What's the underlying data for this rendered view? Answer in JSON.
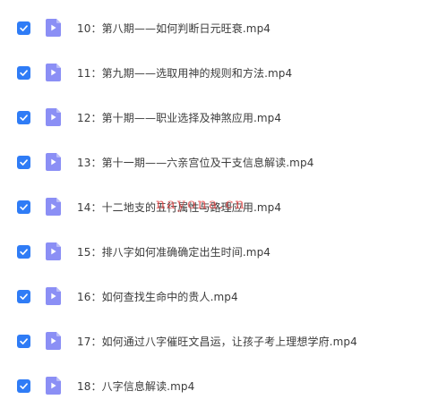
{
  "files": [
    {
      "name": "10：第八期——如何判断日元旺衰.mp4",
      "checked": true
    },
    {
      "name": "11：第九期——选取用神的规则和方法.mp4",
      "checked": true
    },
    {
      "name": "12：第十期——职业选择及神煞应用.mp4",
      "checked": true
    },
    {
      "name": "13：第十一期——六亲宫位及干支信息解读.mp4",
      "checked": true
    },
    {
      "name": "14：十二地支的五行属性与路理应用.mp4",
      "checked": true
    },
    {
      "name": "15：排八字如何准确确定出生时间.mp4",
      "checked": true
    },
    {
      "name": "16：如何查找生命中的贵人.mp4",
      "checked": true
    },
    {
      "name": "17：如何通过八字催旺文昌运，让孩子考上理想学府.mp4",
      "checked": true
    },
    {
      "name": "18：八字信息解读.mp4",
      "checked": true
    }
  ],
  "watermark": "nayona.cn",
  "icons": {
    "checkbox": "checkmark-icon",
    "file": "video-file-icon"
  },
  "colors": {
    "checkbox": "#2f7cf6",
    "file_icon": "#8b8ff5",
    "file_icon_fold": "#b9bcf9",
    "text": "#3b3b3b",
    "watermark": "#e23c3c"
  }
}
